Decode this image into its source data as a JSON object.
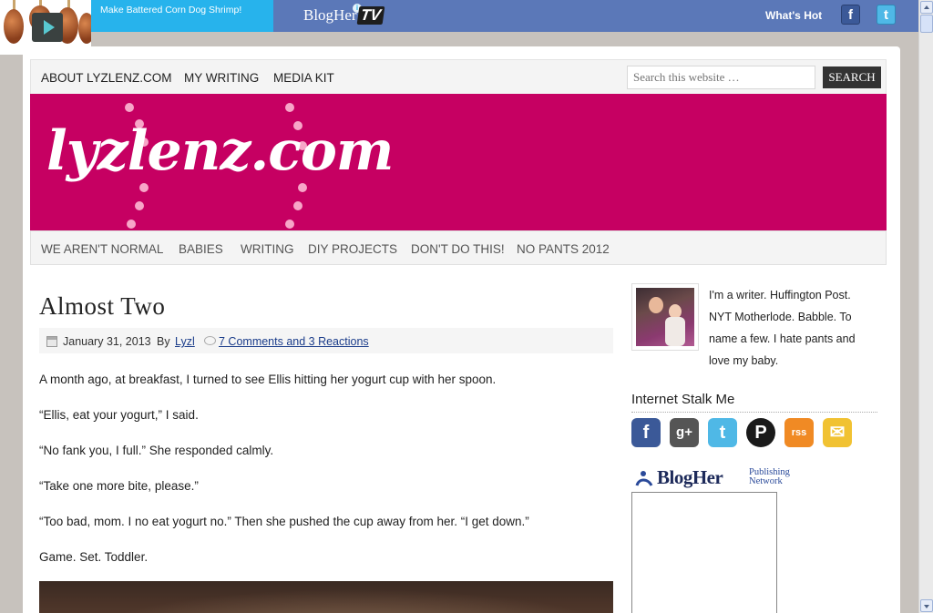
{
  "ad": {
    "text": "Make Battered Corn Dog Shrimp!",
    "info_icon": "info-icon"
  },
  "blogher_bar": {
    "logo_text": "BlogHer",
    "logo_tv": "TV",
    "whats_hot": "What's Hot",
    "facebook_glyph": "f",
    "twitter_glyph": "t"
  },
  "top_nav": {
    "items": [
      "ABOUT LYZLENZ.COM",
      "MY WRITING",
      "MEDIA KIT"
    ],
    "search_placeholder": "Search this website …",
    "search_button": "SEARCH"
  },
  "banner": {
    "title": "lyzlenz.com",
    "background": "#c60062"
  },
  "sub_nav": {
    "items": [
      "WE AREN'T NORMAL",
      "BABIES",
      "WRITING",
      "DIY PROJECTS",
      "DON'T DO THIS!",
      "NO PANTS 2012"
    ]
  },
  "post": {
    "title": "Almost Two",
    "date": "January 31, 2013",
    "by": "By",
    "author": "Lyzl",
    "comments": "7 Comments and 3 Reactions",
    "paragraphs": [
      "A month ago, at breakfast, I turned to see Ellis hitting her yogurt cup with her spoon.",
      "“Ellis, eat your yogurt,” I said.",
      "“No fank you, I full.” She responded calmly.",
      "“Take one more bite, please.”",
      "“Too bad, mom. I no eat yogurt no.” Then she pushed the cup away from her. “I get down.”",
      "Game. Set. Toddler."
    ]
  },
  "sidebar": {
    "bio": "I'm a writer. Huffington Post. NYT Motherlode. Babble. To name a few. I hate pants and love my baby.",
    "stalk_title": "Internet Stalk Me",
    "social": [
      {
        "icon": "facebook-icon",
        "glyph": "f",
        "color": "#3b5998"
      },
      {
        "icon": "google-plus-icon",
        "glyph": "g+",
        "color": "#555555"
      },
      {
        "icon": "twitter-icon",
        "glyph": "t",
        "color": "#4fb8e6"
      },
      {
        "icon": "pinterest-icon",
        "glyph": "P",
        "color": "#1a1a1a"
      },
      {
        "icon": "rss-icon",
        "glyph": "rss",
        "color": "#f08a24"
      },
      {
        "icon": "email-icon",
        "glyph": "✉",
        "color": "#f1c232"
      }
    ],
    "network_logo": "BlogHer",
    "network_sub_1": "Publishing",
    "network_sub_2": "Network"
  }
}
